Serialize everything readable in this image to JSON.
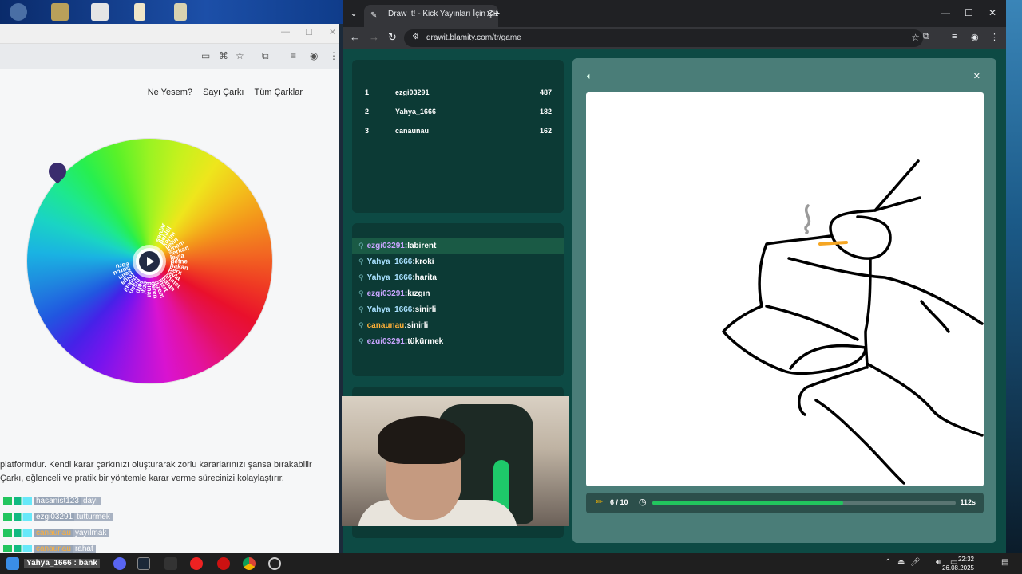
{
  "left_window": {
    "nav": [
      "Ne Yesem?",
      "Sayı Çarkı",
      "Tüm Çarklar"
    ],
    "description_line1": "platformdur. Kendi karar çarkınızı oluşturarak zorlu kararlarınızı şansa bırakabilir",
    "description_line2": "Çarkı, eğlenceli ve pratik bir yöntemle karar verme sürecinizi kolaylaştırır.",
    "wheel_names": [
      "serdar",
      "behlül",
      "kerim",
      "pelin",
      "sinem",
      "serkan",
      "leyla",
      "defne",
      "hakan",
      "berk",
      "leyla",
      "ahmet",
      "baran",
      "mert",
      "gizem",
      "ceren",
      "pınar",
      "ezgi",
      "sarp",
      "nisan",
      "mikail",
      "tolga",
      "selin",
      "burcu",
      "ebru"
    ],
    "chat": [
      {
        "user": "hasanist123",
        "msg": "dayı"
      },
      {
        "user": "ezgi03291",
        "msg": "tutturmek"
      },
      {
        "user": "canaunau",
        "msg": "yayılmak"
      },
      {
        "user": "canaunau",
        "msg": "rahat"
      }
    ]
  },
  "browser": {
    "tab_title": "Draw It! - Kick Yayınları İçin Çiz",
    "url": "drawit.blamity.com/tr/game"
  },
  "leaderboard": [
    {
      "rank": "1",
      "name": "ezgi03291",
      "score": "487"
    },
    {
      "rank": "2",
      "name": "Yahya_1666",
      "score": "182"
    },
    {
      "rank": "3",
      "name": "canaunau",
      "score": "162"
    }
  ],
  "game_chat": [
    {
      "user": "ezgi03291",
      "msg": "labirent",
      "style": "u1",
      "highlight": true
    },
    {
      "user": "Yahya_1666",
      "msg": "kroki",
      "style": "u2",
      "highlight": false
    },
    {
      "user": "Yahya_1666",
      "msg": "harita",
      "style": "u2",
      "highlight": false
    },
    {
      "user": "ezgi03291",
      "msg": "kızgın",
      "style": "u1",
      "highlight": false
    },
    {
      "user": "Yahya_1666",
      "msg": "sinirli",
      "style": "u2",
      "highlight": false
    },
    {
      "user": "canaunau",
      "msg": "sinirli",
      "style": "u3",
      "highlight": false
    },
    {
      "user": "ezgi03291",
      "msg": "tükürmek",
      "style": "u1",
      "highlight": false
    }
  ],
  "game": {
    "round": "6 / 10",
    "time_left": "112s",
    "progress": 0.63
  },
  "taskbar": {
    "user_label": "Yahya_1666 : bank",
    "time": "22:32",
    "date": "26.08.2025"
  },
  "colors": {
    "accent_green": "#22c55e",
    "page_bg": "#0e4641",
    "panel_bg": "#0c3a35"
  }
}
